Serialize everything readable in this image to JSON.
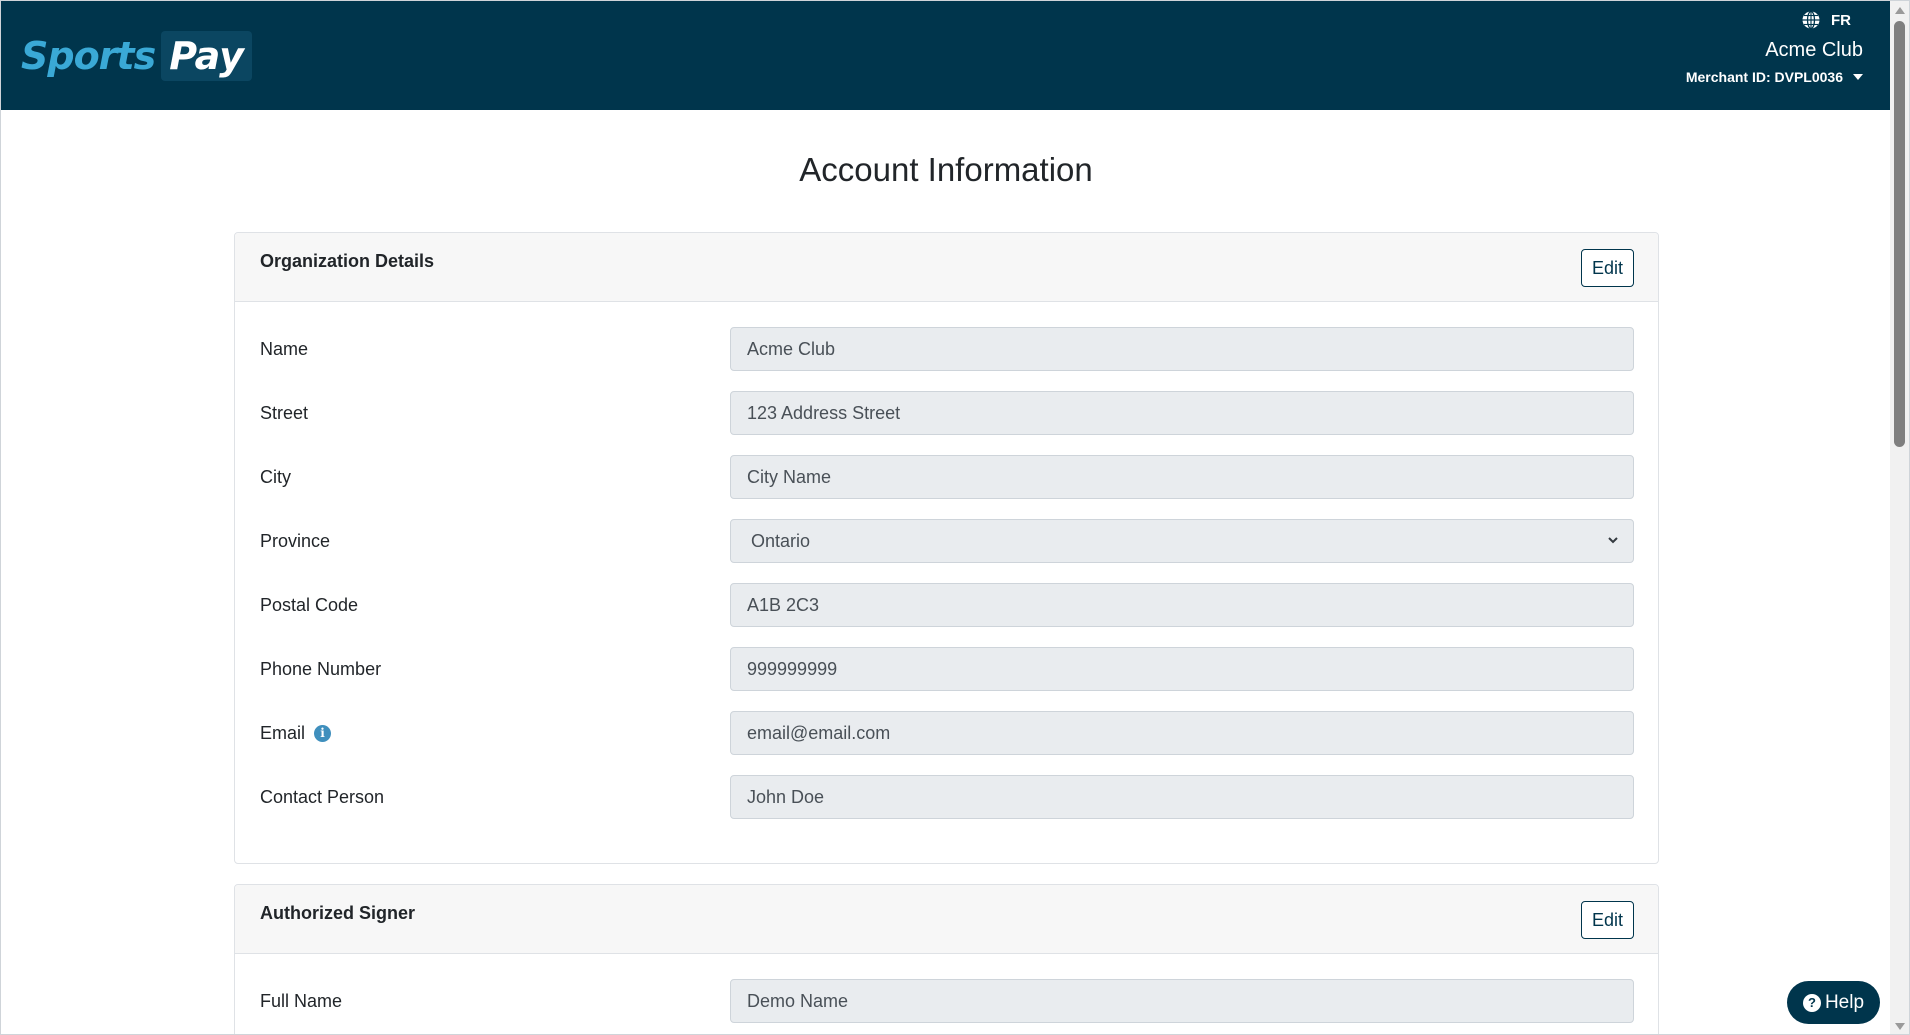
{
  "header": {
    "logo_sports": "Sports",
    "logo_pay": "Pay",
    "language": "FR",
    "club_name": "Acme Club",
    "merchant_id": "Merchant ID: DVPL0036"
  },
  "page": {
    "title": "Account Information"
  },
  "organization": {
    "title": "Organization Details",
    "edit_label": "Edit",
    "fields": {
      "name": {
        "label": "Name",
        "value": "Acme Club"
      },
      "street": {
        "label": "Street",
        "value": "123 Address Street"
      },
      "city": {
        "label": "City",
        "value": "City Name"
      },
      "province": {
        "label": "Province",
        "value": "Ontario"
      },
      "postal": {
        "label": "Postal Code",
        "value": "A1B 2C3"
      },
      "phone": {
        "label": "Phone Number",
        "value": "999999999"
      },
      "email": {
        "label": "Email",
        "value": "email@email.com"
      },
      "contact": {
        "label": "Contact Person",
        "value": "John Doe"
      }
    }
  },
  "signer": {
    "title": "Authorized Signer",
    "edit_label": "Edit",
    "fields": {
      "full_name": {
        "label": "Full Name",
        "value": "Demo Name"
      }
    }
  },
  "help": {
    "label": "Help"
  },
  "colors": {
    "header_bg": "#00354c",
    "accent": "#3aa9d6",
    "field_bg": "#e9ecef"
  }
}
